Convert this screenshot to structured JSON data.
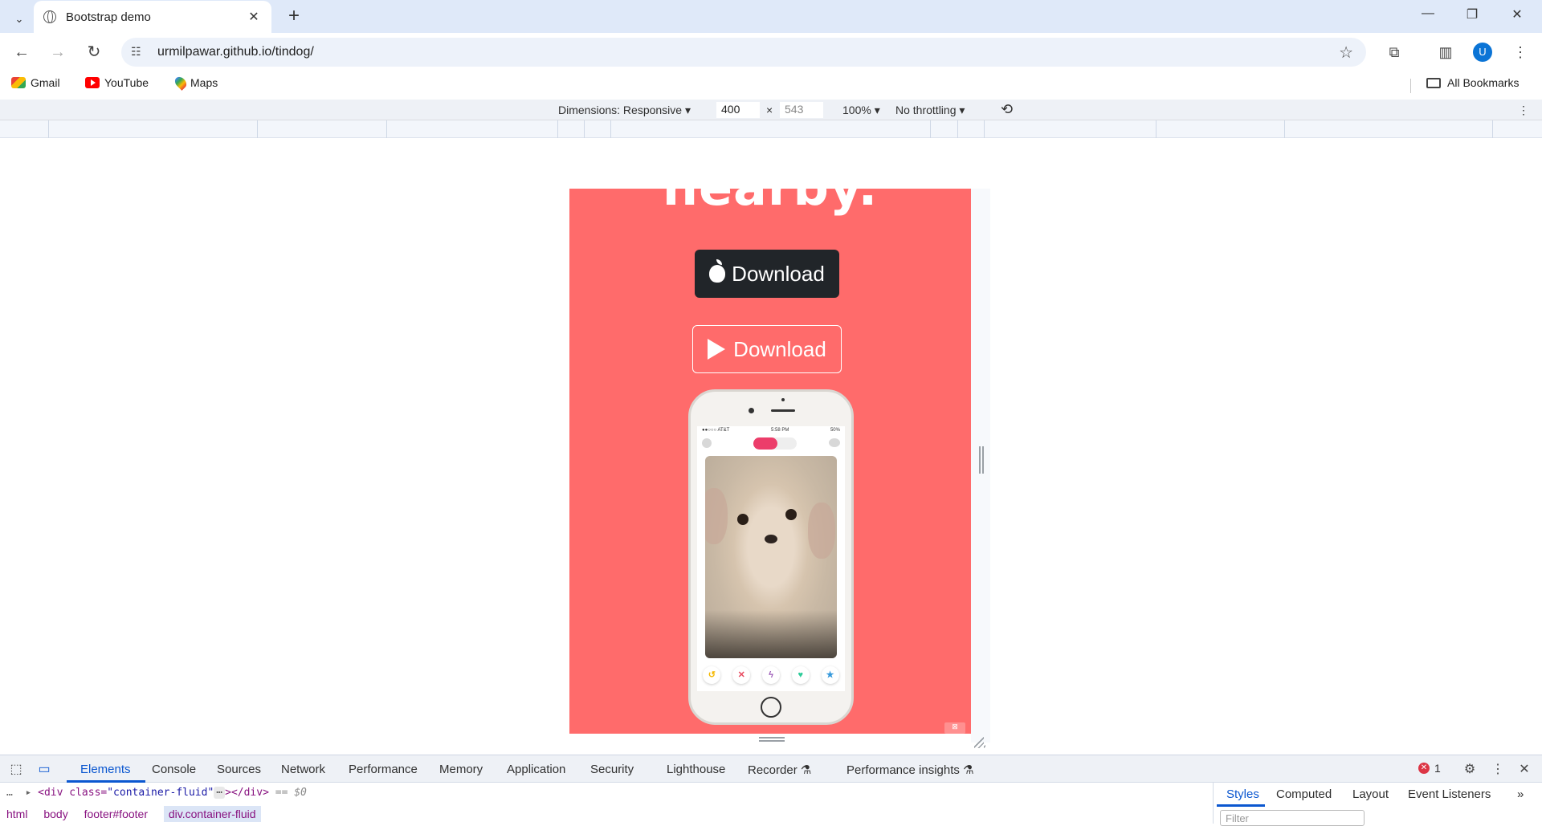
{
  "browser": {
    "tab_title": "Bootstrap demo",
    "url": "urmilpawar.github.io/tindog/",
    "avatar_letter": "U",
    "bookmarks": [
      "Gmail",
      "YouTube",
      "Maps"
    ],
    "all_bookmarks": "All Bookmarks"
  },
  "device_toolbar": {
    "dimensions_label": "Dimensions: Responsive",
    "width": "400",
    "height": "543",
    "times": "×",
    "zoom": "100%",
    "throttling": "No throttling"
  },
  "page": {
    "hero_title": "nearby.",
    "download_apple": "Download",
    "download_google": "Download",
    "phone": {
      "carrier": "●●○○○ AT&T",
      "time": "5:58 PM",
      "battery": "50%"
    },
    "background_color": "#ff6b6b"
  },
  "devtools": {
    "tabs": [
      "Elements",
      "Console",
      "Sources",
      "Network",
      "Performance",
      "Memory",
      "Application",
      "Security",
      "Lighthouse",
      "Recorder",
      "Performance insights"
    ],
    "error_count": "1",
    "dom_line": {
      "open": "<div class=",
      "class_value": "\"container-fluid\"",
      "close": "></div>",
      "marker": "== $0"
    },
    "breadcrumbs": [
      "html",
      "body",
      "footer#footer",
      "div.container-fluid"
    ],
    "styles_tabs": [
      "Styles",
      "Computed",
      "Layout",
      "Event Listeners"
    ],
    "filter_placeholder": "Filter"
  }
}
